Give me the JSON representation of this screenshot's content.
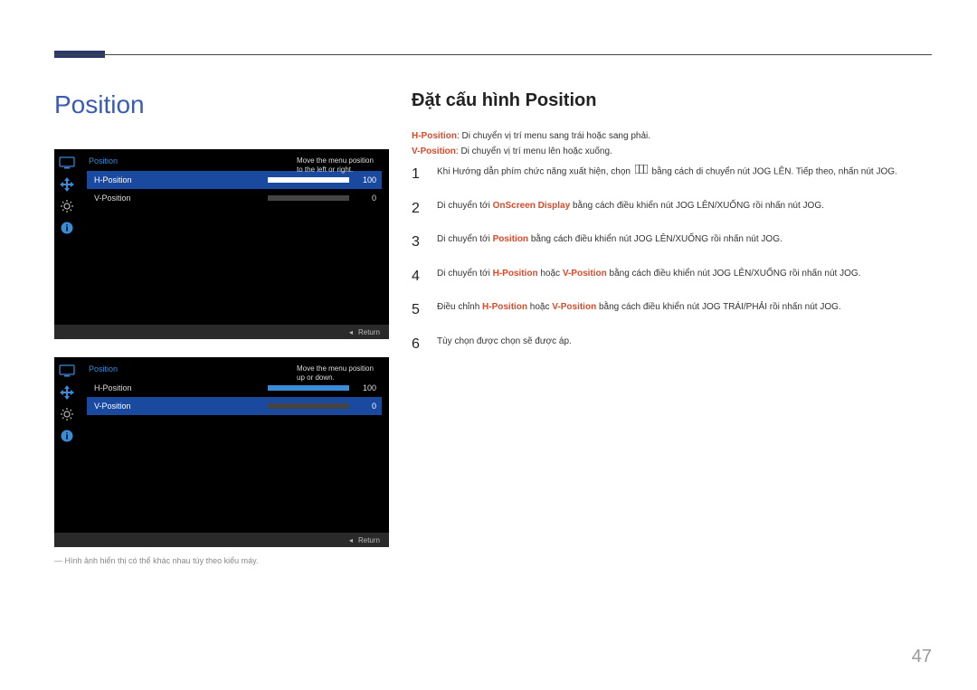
{
  "main_title": "Position",
  "right_title": "Đặt cấu hình Position",
  "definitions": {
    "h_label": "H-Position",
    "h_text": ": Di chuyển vị trí menu sang trái hoặc sang phải.",
    "v_label": "V-Position",
    "v_text": ": Di chuyển vị trí menu lên hoặc xuống."
  },
  "steps": [
    {
      "num": "1",
      "type": "s1",
      "pre": "Khi Hướng dẫn phím chức năng xuất hiện, chọn ",
      "post": " bằng cách di chuyển nút JOG LÊN. Tiếp theo, nhấn nút JOG."
    },
    {
      "num": "2",
      "type": "move",
      "pre": "Di chuyển tới ",
      "r1": "OnScreen Display",
      "post": " bằng cách điều khiển nút JOG LÊN/XUỐNG rồi nhấn nút JOG."
    },
    {
      "num": "3",
      "type": "move",
      "pre": "Di chuyển tới ",
      "r1": "Position",
      "post": " bằng cách điều khiển nút JOG LÊN/XUỐNG rồi nhấn nút JOG."
    },
    {
      "num": "4",
      "type": "hv",
      "pre": "Di chuyển tới ",
      "r1": "H-Position",
      "mid": " hoặc ",
      "r2": "V-Position",
      "post": " bằng cách điều khiển nút JOG LÊN/XUỐNG rồi nhấn nút JOG."
    },
    {
      "num": "5",
      "type": "hv",
      "pre": "Điều chỉnh ",
      "r1": "H-Position",
      "mid": " hoặc ",
      "r2": "V-Position",
      "post": " bằng cách điều khiển nút JOG TRÁI/PHẢI rồi nhấn nút JOG."
    },
    {
      "num": "6",
      "type": "plain",
      "text": "Tùy chọn được chọn sẽ được áp."
    }
  ],
  "osd1": {
    "title": "Position",
    "rows": [
      {
        "label": "H-Position",
        "value": "100",
        "fill": 100,
        "selected": true
      },
      {
        "label": "V-Position",
        "value": "0",
        "fill": 0,
        "selected": false
      }
    ],
    "hint": "Move the menu position to the left or right.",
    "return": "Return"
  },
  "osd2": {
    "title": "Position",
    "rows": [
      {
        "label": "H-Position",
        "value": "100",
        "fill": 100,
        "selected": false
      },
      {
        "label": "V-Position",
        "value": "0",
        "fill": 0,
        "selected": true
      }
    ],
    "hint": "Move the menu position up or down.",
    "return": "Return"
  },
  "caption": "― Hình ảnh hiển thị có thể khác nhau tùy theo kiểu máy.",
  "page_number": "47"
}
